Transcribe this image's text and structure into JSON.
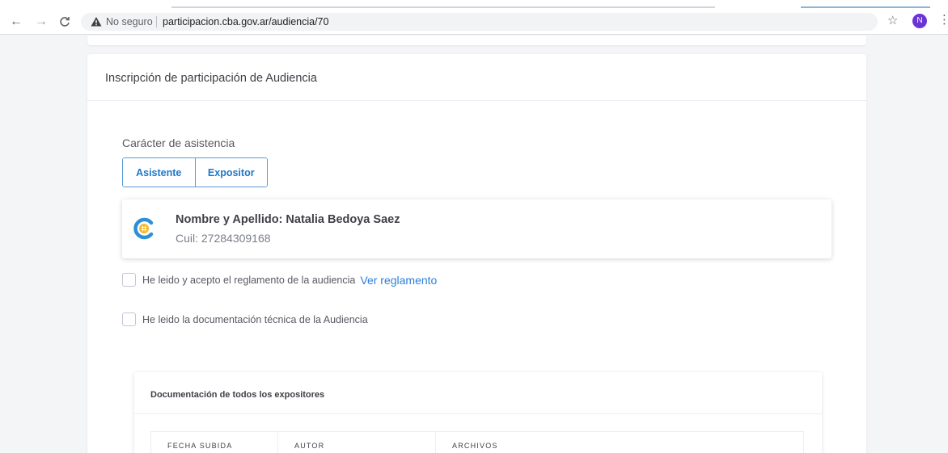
{
  "browser": {
    "security_label": "No seguro",
    "url": "participacion.cba.gov.ar/audiencia/70",
    "profile_initial": "N"
  },
  "card": {
    "title": "Inscripción de participación de Audiencia"
  },
  "attendance": {
    "label": "Carácter de asistencia",
    "options": [
      "Asistente",
      "Expositor"
    ]
  },
  "user": {
    "name": "Nombre y Apellido: Natalia Bedoya Saez",
    "cuil": "Cuil: 27284309168"
  },
  "checks": {
    "reglamento_text": "He leido y acepto el reglamento de la audiencia",
    "reglamento_link": "Ver reglamento",
    "documentacion_text": "He leido la documentación técnica de la Audiencia"
  },
  "docs": {
    "title": "Documentación de todos los expositores",
    "columns": [
      "FECHA SUBIDA",
      "AUTOR",
      "ARCHIVOS"
    ]
  },
  "colors": {
    "accent": "#1f78c8",
    "link": "#2c7fd8",
    "avatar": "#6a34d6"
  },
  "icons": [
    "back-arrow-icon",
    "forward-arrow-icon",
    "reload-icon",
    "warning-icon",
    "star-icon",
    "more-menu-icon",
    "organization-logo-icon"
  ]
}
